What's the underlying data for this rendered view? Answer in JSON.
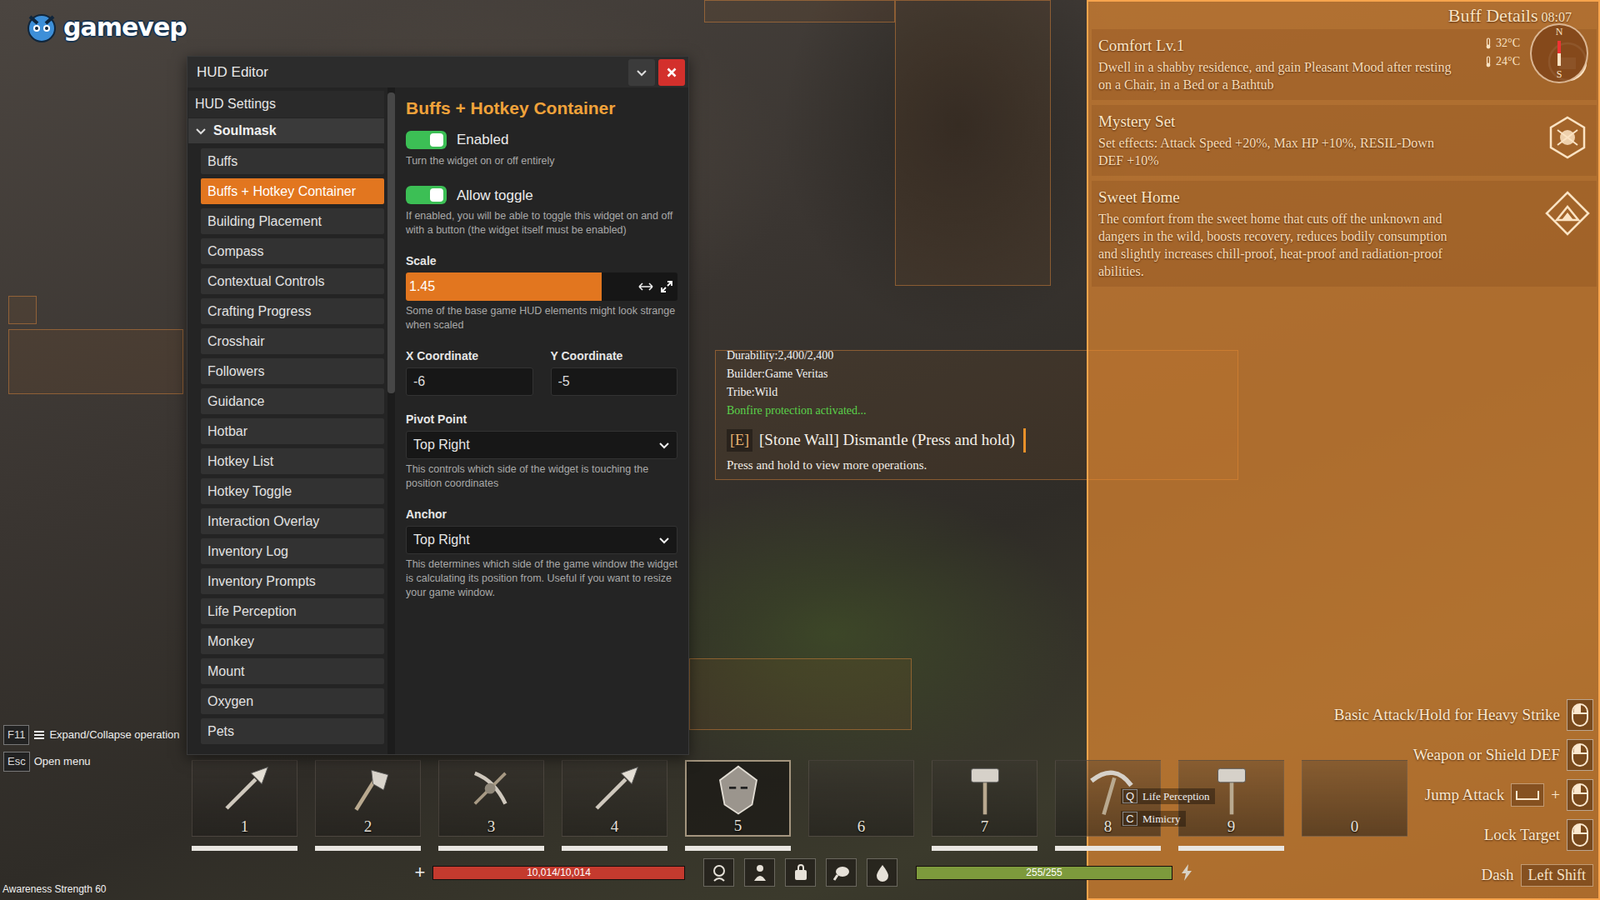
{
  "watermark": {
    "text": "gamevep"
  },
  "editor": {
    "title": "HUD Editor",
    "sidebar": {
      "heading": "HUD Settings",
      "group": {
        "label": "Soulmask",
        "expanded": true
      },
      "items": [
        {
          "label": "Buffs",
          "selected": false
        },
        {
          "label": "Buffs + Hotkey Container",
          "selected": true
        },
        {
          "label": "Building Placement",
          "selected": false
        },
        {
          "label": "Compass",
          "selected": false
        },
        {
          "label": "Contextual Controls",
          "selected": false
        },
        {
          "label": "Crafting Progress",
          "selected": false
        },
        {
          "label": "Crosshair",
          "selected": false
        },
        {
          "label": "Followers",
          "selected": false
        },
        {
          "label": "Guidance",
          "selected": false
        },
        {
          "label": "Hotbar",
          "selected": false
        },
        {
          "label": "Hotkey List",
          "selected": false
        },
        {
          "label": "Hotkey Toggle",
          "selected": false
        },
        {
          "label": "Interaction Overlay",
          "selected": false
        },
        {
          "label": "Inventory Log",
          "selected": false
        },
        {
          "label": "Inventory Prompts",
          "selected": false
        },
        {
          "label": "Life Perception",
          "selected": false
        },
        {
          "label": "Monkey",
          "selected": false
        },
        {
          "label": "Mount",
          "selected": false
        },
        {
          "label": "Oxygen",
          "selected": false
        },
        {
          "label": "Pets",
          "selected": false
        }
      ]
    },
    "panel": {
      "title": "Buffs + Hotkey Container",
      "toggles": [
        {
          "label": "Enabled",
          "on": true,
          "help": "Turn the widget on or off entirely"
        },
        {
          "label": "Allow toggle",
          "on": true,
          "help": "If enabled, you will be able to toggle this widget on and off with a button (the widget itself must be enabled)"
        }
      ],
      "scale": {
        "label": "Scale",
        "value": "1.45",
        "level": 0.72,
        "help": "Some of the base game HUD elements might look strange when scaled"
      },
      "coordinates": [
        {
          "label": "X Coordinate",
          "value": "-6"
        },
        {
          "label": "Y Coordinate",
          "value": "-5"
        }
      ],
      "selects": [
        {
          "label": "Pivot Point",
          "value": "Top Right",
          "help": "This controls which side of the widget is touching the position coordinates"
        },
        {
          "label": "Anchor",
          "value": "Top Right",
          "help": "This determines which side of the game window the widget is calculating its position from. Useful if you want to resize your game window."
        }
      ]
    }
  },
  "buffs": {
    "title": "Buff Details",
    "time": "08:07",
    "items": [
      {
        "name": "Comfort Lv.1",
        "description": "Dwell in a shabby residence, and gain Pleasant Mood after resting on a Chair, in a Bed or a Bathtub"
      },
      {
        "name": "Mystery Set",
        "description": "Set effects: Attack Speed +20%, Max HP +10%, RESIL-Down DEF +10%"
      },
      {
        "name": "Sweet Home",
        "description": "The comfort from the sweet home that cuts off the unknown and dangers in the wild, boosts recovery, reduces bodily consumption and slightly increases chill-proof, heat-proof and radiation-proof abilities."
      }
    ]
  },
  "environment": {
    "temperatures": [
      "32°C",
      "24°C"
    ],
    "compass": {
      "north": "N",
      "south": "S"
    }
  },
  "interaction": {
    "info": [
      "Durability:2,400/2,400",
      "Builder:Game Veritas",
      "Tribe:Wild"
    ],
    "status": "Bonfire protection activated...",
    "key": "[E]",
    "action": "[Stone Wall] Dismantle (Press and hold)",
    "hint": "Press and hold to view more operations."
  },
  "shortcuts": [
    {
      "key": "F11",
      "label": "Expand/Collapse operation",
      "kind": "menu"
    },
    {
      "key": "Esc",
      "label": "Open menu",
      "kind": "plain"
    }
  ],
  "awareness": "Awareness Strength 60",
  "hotbar": [
    {
      "number": "1",
      "filled": true,
      "selected": false
    },
    {
      "number": "2",
      "filled": true,
      "selected": false
    },
    {
      "number": "3",
      "filled": true,
      "selected": false
    },
    {
      "number": "4",
      "filled": true,
      "selected": false
    },
    {
      "number": "5",
      "filled": true,
      "selected": true
    },
    {
      "number": "6",
      "filled": false,
      "selected": false
    },
    {
      "number": "7",
      "filled": true,
      "selected": false
    },
    {
      "number": "8",
      "filled": true,
      "selected": false
    },
    {
      "number": "9",
      "filled": true,
      "selected": false
    },
    {
      "number": "0",
      "filled": false,
      "selected": false
    }
  ],
  "vitals": {
    "icon": "+",
    "health": {
      "reading": "10,014/10,014",
      "level": 1
    },
    "stamina": {
      "reading": "255/255",
      "level": 1
    }
  },
  "skills": [
    {
      "key": "Q",
      "label": "Life Perception"
    },
    {
      "key": "C",
      "label": "Mimicry"
    }
  ],
  "controls": [
    {
      "label": "Basic Attack/Hold for Heavy Strike",
      "kind": "mouse"
    },
    {
      "label": "Weapon or Shield DEF",
      "kind": "mouse"
    },
    {
      "label": "Jump Attack",
      "kind": "combo",
      "joiner": "+"
    },
    {
      "label": "Lock Target",
      "kind": "mouse"
    },
    {
      "label": "Dash",
      "kind": "key",
      "key": "Left Shift"
    }
  ]
}
